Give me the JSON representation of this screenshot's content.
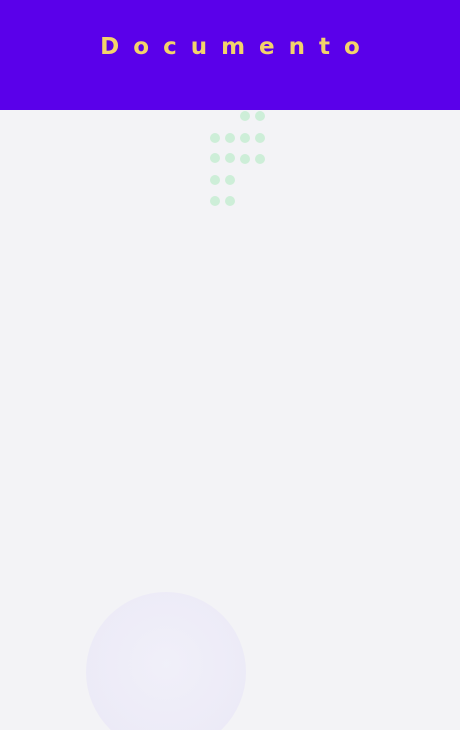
{
  "header": {
    "title": "Documento"
  },
  "colors": {
    "header_background": "#5a00ea",
    "title_text": "#f3d36b",
    "page_background": "#f3f3f6",
    "dot_pattern": "#cdeed8",
    "decor_circle": "#ebe9f7"
  }
}
